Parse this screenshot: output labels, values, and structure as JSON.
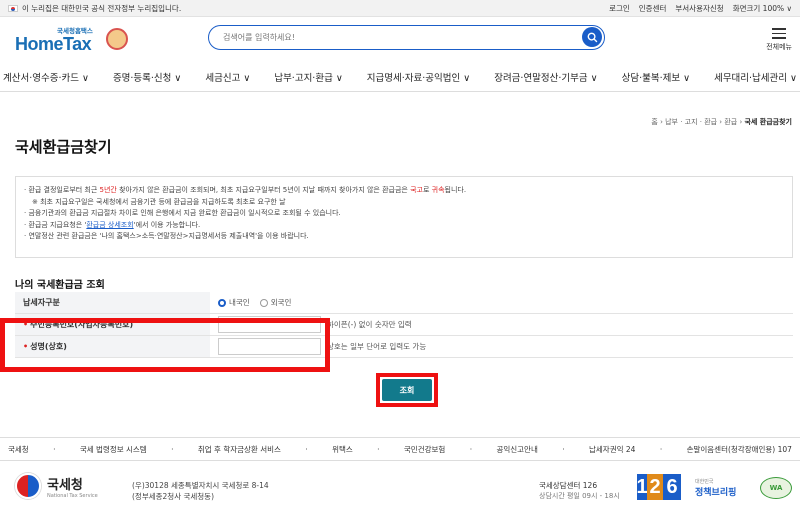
{
  "topbar": {
    "gov_notice": "이 누리집은 대한민국 공식 전자정부 누리집입니다.",
    "links": [
      "로그인",
      "인증센터",
      "부서사용자신청",
      "화면크기 100% ∨"
    ]
  },
  "header": {
    "logo_sub": "국세청홈택스",
    "logo_main": "HomeTax",
    "search_placeholder": "검색어를 입력하세요!",
    "menu_label": "전체메뉴"
  },
  "gnb": [
    "계산서·영수증·카드 ∨",
    "증명·등록·신청 ∨",
    "세금신고 ∨",
    "납부·고지·환급 ∨",
    "지급명세·자료·공익법인 ∨",
    "장려금·연말정산·기부금 ∨",
    "상담·불복·제보 ∨",
    "세무대리·납세관리 ∨"
  ],
  "breadcrumb": {
    "path": "홈 › 납부 · 고지 · 환급 › 환급 › ",
    "current": "국세 환급금찾기"
  },
  "page_title": "국세환급금찾기",
  "notice": {
    "l1a": "· 환급 결정일로부터 최근 ",
    "l1b": "5년간",
    "l1c": " 찾아가지 않은 환급금이 조회되며, 최초 지급요구일부터 5년이 지날 때까지 찾아가지 않은 환급금은 ",
    "l1d": "국고",
    "l1e": "로 ",
    "l1f": "귀속",
    "l1g": "됩니다.",
    "l2": "※ 최초 지급요구일은 국세청에서 금융기관 등에 환급금을 지급하도록 최초로 요구한 날",
    "l3": "· 금융기관과의 환급금 지급절차 차이로 인해 은행에서 지금 완료한 환급금이 일시적으로 조회될 수 있습니다.",
    "l4a": "· 환급금 지급요청은 '",
    "l4b": "환급금 상세조회",
    "l4c": "'에서 이용 가능합니다.",
    "l5": "· 연말정산 관련 환급금은 '나의 홈택스>소득·연말정산>지급명세서등 제출내역'을 이용 바랍니다."
  },
  "section_title": "나의 국세환급금 조회",
  "form": {
    "row1_label": "납세자구분",
    "radio1": "내국인",
    "radio2": "외국인",
    "row2_label": "주민등록번호(사업자등록번호)",
    "row2_hint": "하이픈(-) 없이 숫자만 입력",
    "row3_label": "성명(상호)",
    "row3_hint": "상호는 일부 단어로 입력도 가능",
    "required_mark": "•"
  },
  "search_button": "조회",
  "footer_links": [
    "국세청",
    "·",
    "국세 법령정보 시스템",
    "·",
    "취업 후 학자금상환 서비스",
    "·",
    "위택스",
    "·",
    "국민건강보험",
    "·",
    "공익신고안내",
    "·",
    "납세자권익 24",
    "·",
    "손말이음센터(청각장애인용) 107"
  ],
  "footer": {
    "org_name": "국세청",
    "org_en": "National Tax Service",
    "addr1": "(우)30128 세종특별자치시 국세청로 8-14",
    "addr2": "(정부세종2청사 국세청동)",
    "center_title": "국세상담센터 126",
    "center_hours": "상담시간 평일 09시 - 18시",
    "num": [
      "1",
      "2",
      "6"
    ],
    "brief_small": "대한민국",
    "brief": "정책브리핑",
    "was": "WA"
  },
  "colors": {
    "accent": "#1a5dc8",
    "button": "#127a8c",
    "highlight": "#e11111"
  }
}
